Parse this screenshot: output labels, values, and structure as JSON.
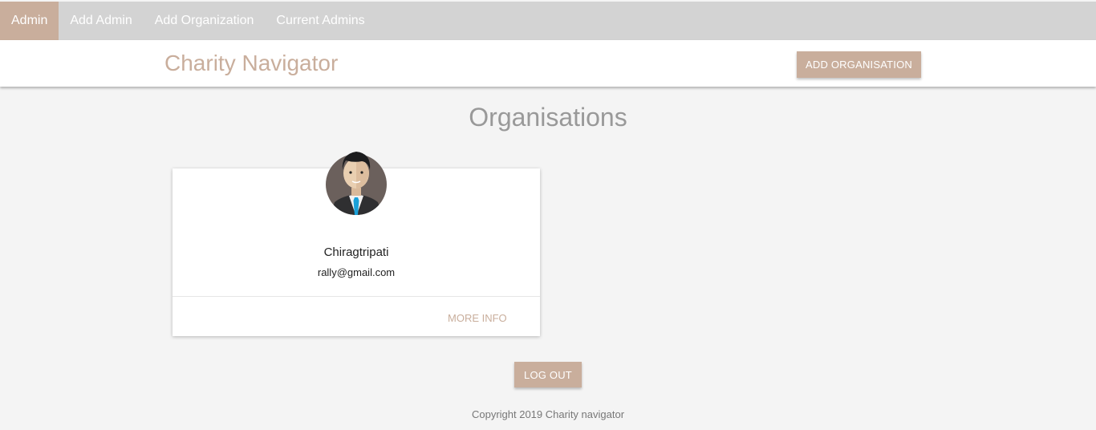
{
  "nav": {
    "items": [
      {
        "label": "Admin"
      },
      {
        "label": "Add Admin"
      },
      {
        "label": "Add Organization"
      },
      {
        "label": "Current Admins"
      }
    ]
  },
  "header": {
    "brand": "Charity Navigator",
    "add_button_label": "ADD ORGANISATION"
  },
  "main": {
    "title": "Organisations",
    "cards": [
      {
        "name": "Chiragtripati",
        "email": "rally@gmail.com",
        "action_label": "MORE INFO",
        "avatar_icon": "businessman-avatar-icon"
      }
    ],
    "logout_label": "LOG OUT"
  },
  "footer": {
    "copyright": "Copyright 2019 Charity navigator"
  },
  "colors": {
    "accent": "#c9ae9c",
    "nav_bg": "#d3d3d3",
    "page_bg": "#f4f4f4",
    "title_gray": "#999999"
  }
}
